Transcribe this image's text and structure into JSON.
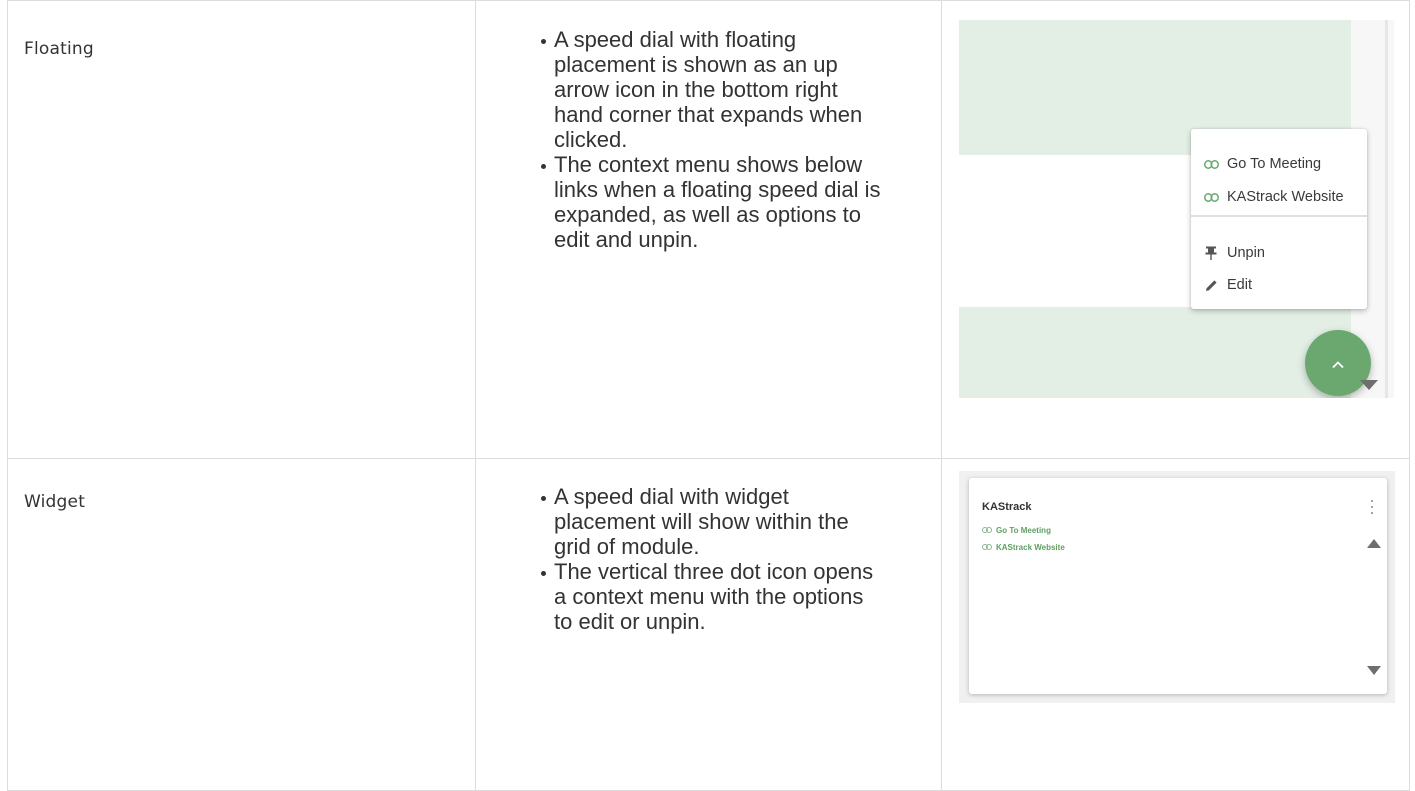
{
  "rows": [
    {
      "placement": "Floating",
      "bullets": [
        "A speed dial with floating placement is shown as an up arrow icon in the bottom right hand corner that expands when clicked.",
        "The context menu shows below links when a floating speed dial is expanded, as well as options to edit and unpin."
      ],
      "preview": {
        "menu_links": [
          "Go To Meeting",
          "KAStrack Website"
        ],
        "menu_actions": [
          "Unpin",
          "Edit"
        ],
        "icons": {
          "link": "link-icon",
          "unpin": "pin-icon",
          "edit": "pencil-icon",
          "fab": "chevron-up-icon",
          "scroll": "triangle-down-icon"
        },
        "colors": {
          "band": "#e3efe5",
          "fab": "#6aa86f",
          "link_icon": "#6aa86f"
        }
      }
    },
    {
      "placement": "Widget",
      "bullets": [
        "A speed dial with widget placement will show within the grid of module.",
        "The vertical three dot icon opens a context menu with the options to edit or unpin."
      ],
      "preview": {
        "title": "KAStrack",
        "links": [
          "Go To Meeting",
          "KAStrack Website"
        ],
        "icons": {
          "menu": "kebab-menu-icon",
          "link": "link-icon",
          "scroll_up": "triangle-up-icon",
          "scroll_down": "triangle-down-icon"
        },
        "colors": {
          "link_text": "#5f9e63"
        }
      }
    }
  ]
}
